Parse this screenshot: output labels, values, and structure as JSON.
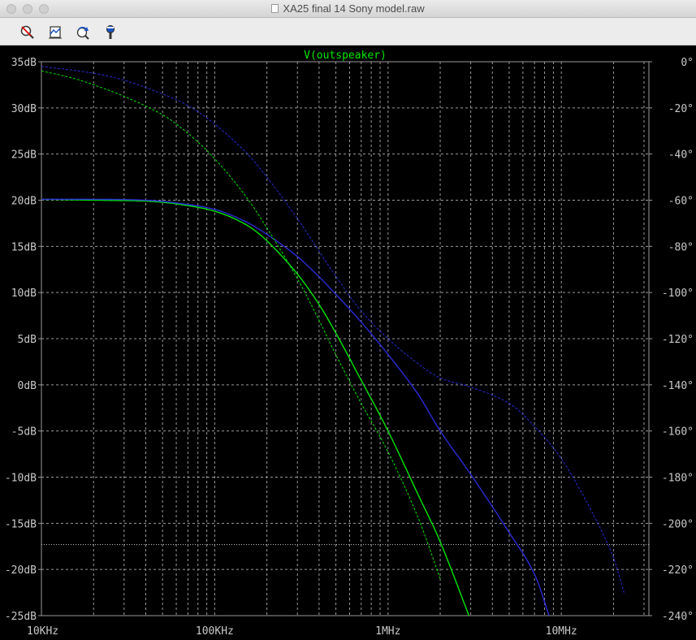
{
  "window": {
    "title": "XA25 final 14 Sony model.raw"
  },
  "toolbar": {
    "icons": [
      "zoom-cancel-icon",
      "autorange-icon",
      "undo-zoom-icon",
      "probe-icon"
    ]
  },
  "colors": {
    "background": "#000000",
    "grid": "#9a9a9a",
    "green": "#00e600",
    "blue": "#2b2bd8",
    "legend": "#00e600"
  },
  "chart_data": {
    "type": "line",
    "title": "V(outspeaker)",
    "x_scale": "log",
    "xlim": [
      10000,
      32000000
    ],
    "x_ticks": [
      {
        "value": 10000,
        "label": "10KHz"
      },
      {
        "value": 100000,
        "label": "100KHz"
      },
      {
        "value": 1000000,
        "label": "1MHz"
      },
      {
        "value": 10000000,
        "label": "10MHz"
      }
    ],
    "y_left": {
      "ylim": [
        -25,
        35
      ],
      "ticks": [
        "35dB",
        "30dB",
        "25dB",
        "20dB",
        "15dB",
        "10dB",
        "5dB",
        "0dB",
        "-5dB",
        "-10dB",
        "-15dB",
        "-20dB",
        "-25dB"
      ],
      "tick_values": [
        35,
        30,
        25,
        20,
        15,
        10,
        5,
        0,
        -5,
        -10,
        -15,
        -20,
        -25
      ]
    },
    "y_right": {
      "ylim": [
        -240,
        0
      ],
      "ticks": [
        "0°",
        "-20°",
        "-40°",
        "-60°",
        "-80°",
        "-100°",
        "-120°",
        "-140°",
        "-160°",
        "-180°",
        "-200°",
        "-220°",
        "-240°"
      ],
      "tick_values": [
        0,
        -20,
        -40,
        -60,
        -80,
        -100,
        -120,
        -140,
        -160,
        -180,
        -200,
        -220,
        -240
      ]
    },
    "grid": true,
    "cursor_line_db": -17.3,
    "series": [
      {
        "color": "green",
        "style": "solid",
        "axis": "left",
        "quantity": "magnitude",
        "points": [
          [
            10000,
            20.1
          ],
          [
            20000,
            20.0
          ],
          [
            40000,
            19.9
          ],
          [
            60000,
            19.6
          ],
          [
            100000,
            18.8
          ],
          [
            150000,
            17.4
          ],
          [
            200000,
            15.6
          ],
          [
            300000,
            12.0
          ],
          [
            400000,
            8.7
          ],
          [
            500000,
            5.6
          ],
          [
            700000,
            0.5
          ],
          [
            1000000,
            -5.0
          ],
          [
            1500000,
            -12.0
          ],
          [
            2000000,
            -17.0
          ],
          [
            3000000,
            -25.5
          ]
        ]
      },
      {
        "color": "blue",
        "style": "solid",
        "axis": "left",
        "quantity": "magnitude",
        "points": [
          [
            10000,
            20.1
          ],
          [
            20000,
            20.1
          ],
          [
            40000,
            20.0
          ],
          [
            60000,
            19.7
          ],
          [
            100000,
            19.0
          ],
          [
            150000,
            17.7
          ],
          [
            200000,
            16.3
          ],
          [
            300000,
            13.9
          ],
          [
            400000,
            11.7
          ],
          [
            500000,
            9.8
          ],
          [
            700000,
            6.8
          ],
          [
            1000000,
            3.3
          ],
          [
            1500000,
            -1.1
          ],
          [
            2000000,
            -5.0
          ],
          [
            3000000,
            -9.7
          ],
          [
            5000000,
            -16.0
          ],
          [
            7000000,
            -20.5
          ],
          [
            8500000,
            -25.0
          ]
        ]
      },
      {
        "color": "green",
        "style": "dashed",
        "axis": "right",
        "quantity": "phase",
        "points": [
          [
            10000,
            -4
          ],
          [
            15000,
            -7
          ],
          [
            20000,
            -10
          ],
          [
            30000,
            -15
          ],
          [
            50000,
            -23
          ],
          [
            70000,
            -31
          ],
          [
            100000,
            -42
          ],
          [
            150000,
            -58
          ],
          [
            200000,
            -72
          ],
          [
            300000,
            -94
          ],
          [
            400000,
            -112
          ],
          [
            500000,
            -127
          ],
          [
            700000,
            -148
          ],
          [
            1000000,
            -169
          ],
          [
            1500000,
            -198
          ],
          [
            2000000,
            -224
          ]
        ]
      },
      {
        "color": "blue",
        "style": "dashed",
        "axis": "right",
        "quantity": "phase",
        "points": [
          [
            10000,
            -2
          ],
          [
            20000,
            -5
          ],
          [
            30000,
            -8
          ],
          [
            50000,
            -14
          ],
          [
            70000,
            -19
          ],
          [
            100000,
            -27
          ],
          [
            150000,
            -39
          ],
          [
            200000,
            -50
          ],
          [
            300000,
            -68
          ],
          [
            500000,
            -93
          ],
          [
            700000,
            -108
          ],
          [
            1000000,
            -120
          ],
          [
            1500000,
            -131
          ],
          [
            2000000,
            -137
          ],
          [
            3000000,
            -141
          ],
          [
            5000000,
            -148
          ],
          [
            7000000,
            -158
          ],
          [
            10000000,
            -172
          ],
          [
            15000000,
            -195
          ],
          [
            20000000,
            -215
          ],
          [
            23000000,
            -230
          ]
        ]
      }
    ]
  }
}
